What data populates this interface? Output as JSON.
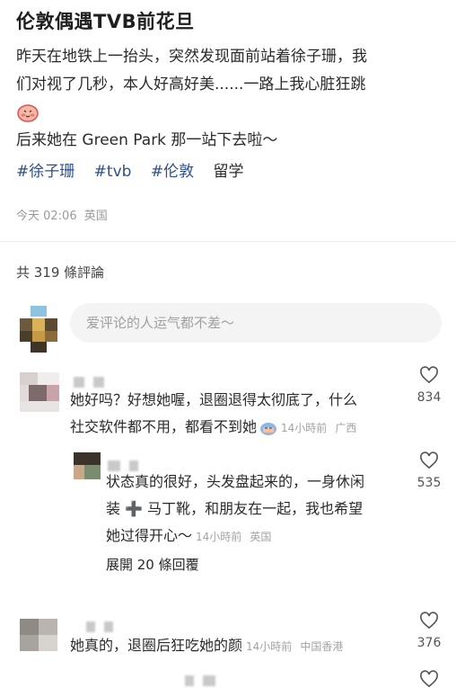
{
  "post": {
    "title": "伦敦偶遇TVB前花旦",
    "body_lines": [
      "昨天在地铁上一抬头，突然发现面前站着徐子珊，我",
      "们对视了几秒，本人好高好美......一路上我心脏狂跳",
      "",
      "后来她在 Green Park 那一站下去啦～"
    ],
    "tags": [
      "#徐子珊",
      "#tvb",
      "#伦敦"
    ],
    "tag_plain": "留学",
    "time": "今天 02:06",
    "location": "英国"
  },
  "comments_header": {
    "count_text": "共 319 條評論"
  },
  "comment_input": {
    "placeholder": "爱评论的人运气都不差～"
  },
  "comments": [
    {
      "lines": [
        "她好吗？好想她喔，退圈退得太彻底了，什么",
        "社交软件都不用，都看不到她"
      ],
      "time": "14小時前",
      "location": "广西",
      "likes": "834"
    },
    {
      "lines": [
        "状态真的很好，头发盘起来的，一身休闲",
        "装 ➕ 马丁靴，和朋友在一起，我也希望",
        "她过得开心～"
      ],
      "time": "14小時前",
      "location": "英国",
      "likes": "535"
    },
    {
      "lines": [
        "她真的，退圈后狂吃她的颜"
      ],
      "time": "14小時前",
      "location": "中国香港",
      "likes": "376"
    }
  ],
  "expand_replies": "展開 20 條回覆",
  "icons": {
    "like": "heart-outline-icon",
    "emoji_blush": "blushing-face-emoji-icon",
    "emoji_sweat": "sweating-face-emoji-icon"
  },
  "colors": {
    "tag": "#2b4f8e",
    "meta": "#9a9a9a",
    "input_bg": "#f4f4f5"
  }
}
